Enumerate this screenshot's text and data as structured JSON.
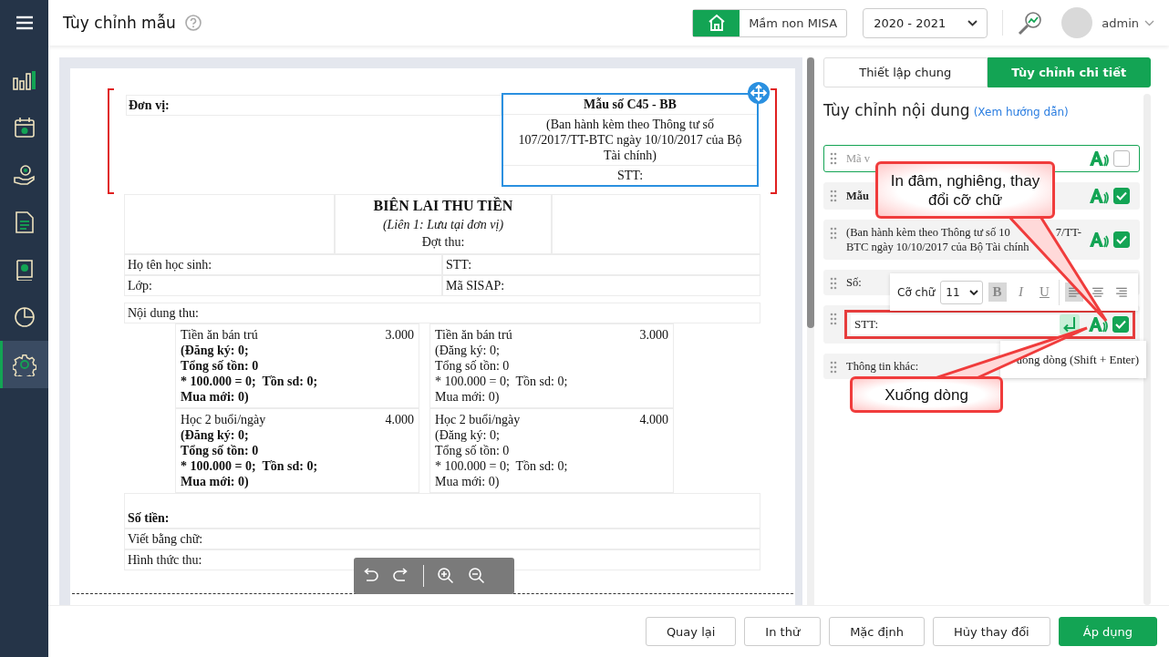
{
  "sidebar": {
    "items": [
      {
        "kind": "chart",
        "selected": false
      },
      {
        "kind": "calendar",
        "selected": false
      },
      {
        "kind": "coin-hand",
        "selected": false
      },
      {
        "kind": "document",
        "selected": false
      },
      {
        "kind": "book",
        "selected": false
      },
      {
        "kind": "pie",
        "selected": false
      },
      {
        "kind": "gear",
        "selected": true
      }
    ]
  },
  "header": {
    "title": "Tùy chỉnh mẫu",
    "school": "Mầm non MISA",
    "year": "2020 - 2021",
    "user": "admin"
  },
  "document": {
    "unit_label": "Đơn vị:",
    "form_code": "Mẫu số C45 - BB",
    "form_note": "(Ban hành kèm theo Thông tư số 107/2017/TT-BTC ngày 10/10/2017 của Bộ Tài chính)",
    "form_stt": "STT:",
    "title": "BIÊN LAI THU TIỀN",
    "subtitle": "(Liên 1: Lưu tại đơn vị)",
    "period": "Đợt thu:",
    "fields": [
      [
        "Họ tên học sinh:",
        "STT:"
      ],
      [
        "Lớp:",
        "Mã SISAP:"
      ]
    ],
    "content_label": "Nội dung thu:",
    "items": [
      {
        "name": "Tiền ăn bán trú",
        "amount": "3.000",
        "bold": true,
        "lines": [
          "(Đăng ký: 0;",
          "Tổng số tồn: 0",
          "* 100.000 = 0;  Tồn sd: 0;",
          "Mua mới: 0)"
        ]
      },
      {
        "name": "Tiền ăn bán trú",
        "amount": "3.000",
        "bold": false,
        "lines": [
          "(Đăng ký: 0;",
          "Tổng số tồn: 0",
          "* 100.000 = 0;  Tồn sd: 0;",
          "Mua mới: 0)"
        ]
      },
      {
        "name": "Học 2 buổi/ngày",
        "amount": "4.000",
        "bold": true,
        "lines": [
          "(Đăng ký: 0;",
          "Tổng số tồn: 0",
          "* 100.000 = 0;  Tồn sd: 0;",
          "Mua mới: 0)"
        ]
      },
      {
        "name": "Học 2 buổi/ngày",
        "amount": "4.000",
        "bold": false,
        "lines": [
          "(Đăng ký: 0;",
          "Tổng số tồn: 0",
          "* 100.000 = 0;  Tồn sd: 0;",
          "Mua mới: 0)"
        ]
      }
    ],
    "amount_label": "Số tiền:",
    "words_label": "Viết bằng chữ:",
    "method_label": "Hình thức thu:"
  },
  "panel": {
    "tabs": [
      {
        "label": "Thiết lập chung",
        "selected": false
      },
      {
        "label": "Tùy chỉnh chi tiết",
        "selected": true
      }
    ],
    "heading": "Tùy chỉnh nội dung",
    "help_link": "(Xem hướng dẫn)",
    "rows": [
      {
        "lines": [
          [
            "Mã v"
          ]
        ],
        "muted": true,
        "bold": false,
        "focused": true,
        "editing": false,
        "checked": false
      },
      {
        "lines": [
          [
            "Mẫu"
          ]
        ],
        "muted": false,
        "bold": true,
        "focused": false,
        "editing": false,
        "checked": true
      },
      {
        "lines": [
          [
            "(Ban hành kèm theo Thông tư số 10",
            "7/TT-"
          ],
          [
            "BTC ngày 10/10/2017 của Bộ Tài chính"
          ]
        ],
        "muted": false,
        "bold": false,
        "focused": false,
        "editing": false,
        "checked": true
      },
      {
        "lines": [
          [
            "Số:"
          ]
        ],
        "muted": false,
        "bold": false,
        "focused": false,
        "editing": false
      },
      {
        "lines": [
          [
            "STT:"
          ]
        ],
        "muted": false,
        "bold": false,
        "focused": false,
        "editing": true,
        "highlighted": true,
        "checked": true
      },
      {
        "lines": [
          [
            "Thông tin khác:"
          ]
        ],
        "muted": false,
        "bold": false,
        "focused": false,
        "editing": false
      }
    ],
    "format_bar": {
      "label": "Cỡ chữ",
      "size": "11",
      "styles": [
        {
          "kind": "bold",
          "label": "B",
          "selected": true
        },
        {
          "kind": "italic",
          "label": "I",
          "selected": false
        },
        {
          "kind": "underline",
          "label": "U",
          "selected": false
        }
      ],
      "aligns": [
        {
          "kind": "left",
          "selected": true
        },
        {
          "kind": "center",
          "selected": false
        },
        {
          "kind": "right",
          "selected": false
        }
      ]
    },
    "tooltip": "uống dòng (Shift + Enter)"
  },
  "buttons": [
    {
      "label": "Quay lại",
      "primary": false
    },
    {
      "label": "In thử",
      "primary": false
    },
    {
      "label": "Mặc định",
      "primary": false
    },
    {
      "label": "Hủy thay đổi",
      "primary": false
    },
    {
      "label": "Áp dụng",
      "primary": true
    }
  ],
  "callouts": [
    {
      "text": "In đâm, nghiêng, thay đổi cỡ chữ"
    },
    {
      "text": "Xuống dòng"
    }
  ]
}
